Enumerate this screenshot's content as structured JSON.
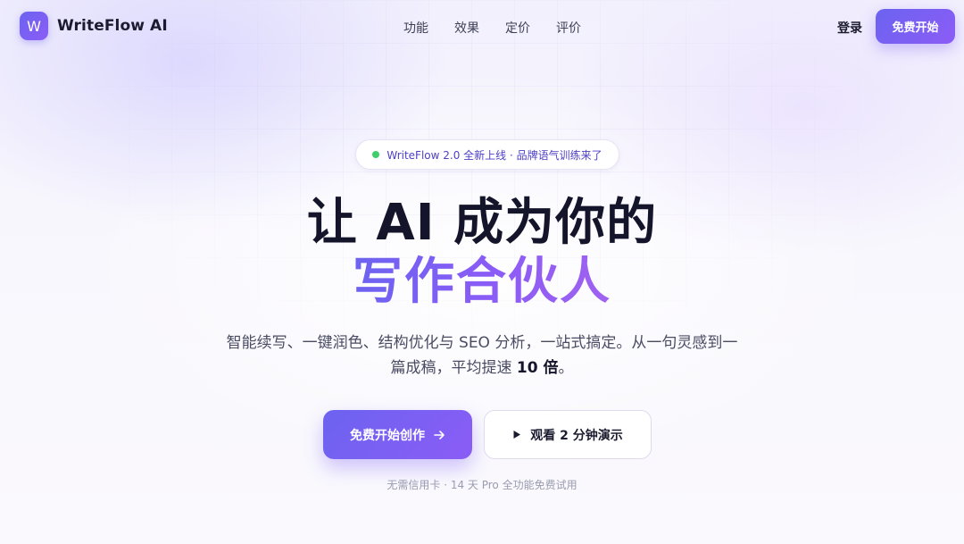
{
  "nav": {
    "brand_logo_letter": "W",
    "brand_name": "WriteFlow AI",
    "links": [
      "功能",
      "效果",
      "定价",
      "评价"
    ],
    "login_label": "登录",
    "start_label": "免费开始"
  },
  "badge": {
    "text": "WriteFlow 2.0 全新上线 · 品牌语气训练来了",
    "dot_color": "#3fcf6a"
  },
  "hero": {
    "title_line1": "让 AI 成为你的",
    "title_line2": "写作合伙人",
    "subtitle_pre": "智能续写、一键润色、结构优化与 SEO 分析，一站式搞定。从一句灵感到一篇成稿，平均提速 ",
    "subtitle_bold": "10 倍",
    "subtitle_post": "。",
    "primary_cta_label": "免费开始创作",
    "primary_cta_icon": "arrow-right-icon",
    "secondary_cta_label": "观看 2 分钟演示",
    "secondary_cta_icon": "play-icon",
    "note": "无需信用卡 · 14 天 Pro 全功能免费试用"
  },
  "colors": {
    "accent_start": "#6c63f0",
    "accent_end": "#8b5cf6",
    "text_dark": "#14152a"
  }
}
